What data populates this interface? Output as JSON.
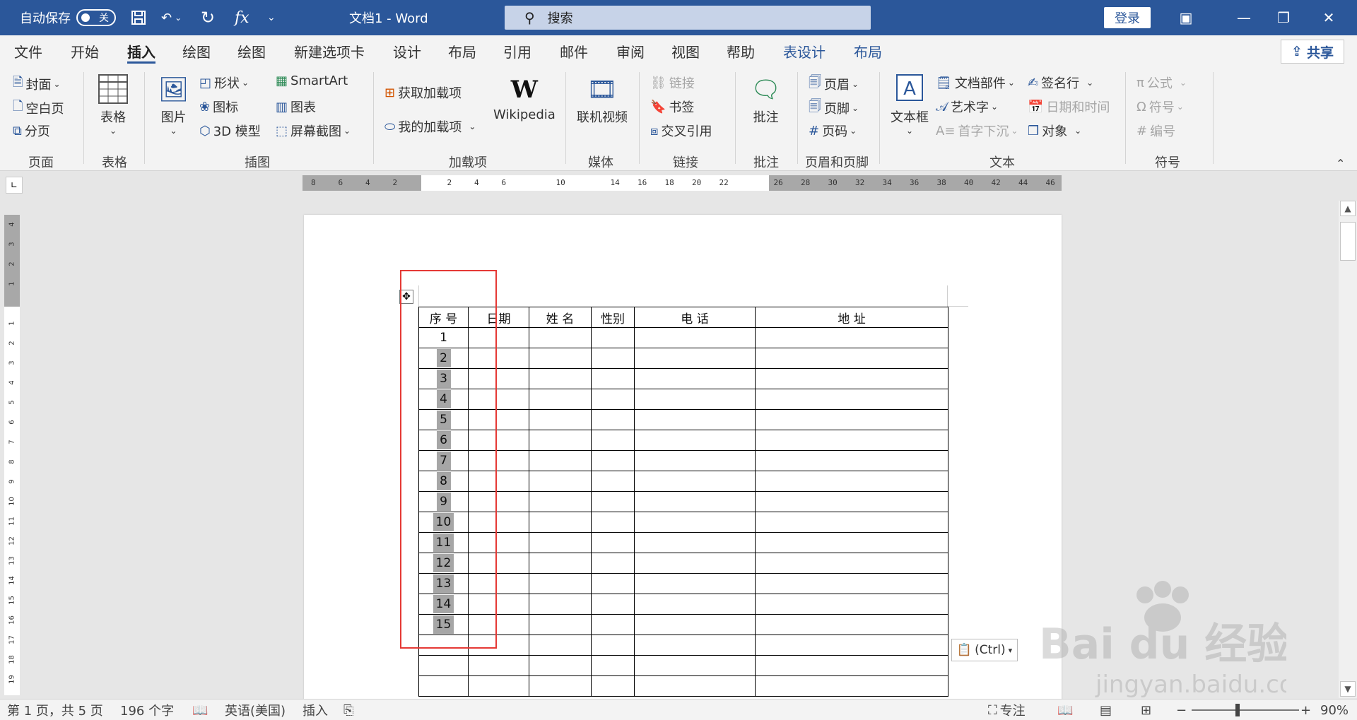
{
  "titlebar": {
    "autosave_label": "自动保存",
    "autosave_state": "关",
    "undo_icon": "undo-icon",
    "fx_label": "fx",
    "doc_title": "文档1 - Word",
    "search_placeholder": "搜索",
    "login_label": "登录"
  },
  "tabs": [
    "文件",
    "开始",
    "插入",
    "绘图",
    "绘图",
    "新建选项卡",
    "设计",
    "布局",
    "引用",
    "邮件",
    "审阅",
    "视图",
    "帮助",
    "表设计",
    "布局"
  ],
  "share_label": "共享",
  "ribbon": {
    "page_group": {
      "items": [
        "封面",
        "空白页",
        "分页"
      ],
      "label": "页面"
    },
    "table_group": {
      "button": "表格",
      "label": "表格"
    },
    "illus_group": {
      "picture": "图片",
      "shapes": "形状",
      "icons": "图标",
      "model3d": "3D 模型",
      "smartart": "SmartArt",
      "chart": "图表",
      "screenshot": "屏幕截图",
      "label": "插图"
    },
    "addins_group": {
      "get": "获取加载项",
      "mine": "我的加载项",
      "wiki": "Wikipedia",
      "label": "加载项"
    },
    "media_group": {
      "video": "联机视频",
      "label": "媒体"
    },
    "links_group": {
      "link": "链接",
      "bookmark": "书签",
      "cross": "交叉引用",
      "label": "链接"
    },
    "comment_group": {
      "comment": "批注",
      "label": "批注"
    },
    "hf_group": {
      "header": "页眉",
      "footer": "页脚",
      "pagenum": "页码",
      "label": "页眉和页脚"
    },
    "text_group": {
      "textbox": "文本框",
      "parts": "文档部件",
      "wordart": "艺术字",
      "dropcap": "首字下沉",
      "sig": "签名行",
      "datetime": "日期和时间",
      "object": "对象",
      "label": "文本"
    },
    "symbols_group": {
      "equation": "公式",
      "symbol": "符号",
      "number": "编号",
      "label": "符号"
    }
  },
  "ruler_ticks": [
    "8",
    "6",
    "4",
    "2",
    "",
    "2",
    "4",
    "6",
    "",
    "10",
    "",
    "14",
    "16",
    "18",
    "20",
    "22",
    "",
    "26",
    "28",
    "30",
    "32",
    "34",
    "36",
    "38",
    "40",
    "42",
    "44",
    "46"
  ],
  "vruler_ticks": [
    "4",
    "3",
    "2",
    "1",
    "",
    "1",
    "2",
    "3",
    "4",
    "5",
    "6",
    "7",
    "8",
    "9",
    "10",
    "11",
    "12",
    "13",
    "14",
    "15",
    "16",
    "17",
    "18",
    "19"
  ],
  "table": {
    "headers": [
      "序 号",
      "日期",
      "姓  名",
      "性别",
      "电  话",
      "地    址"
    ],
    "rows": [
      "1",
      "2",
      "3",
      "4",
      "5",
      "6",
      "7",
      "8",
      "9",
      "10",
      "11",
      "12",
      "13",
      "14",
      "15",
      "",
      "",
      ""
    ]
  },
  "paste_options_label": "(Ctrl)",
  "status": {
    "page": "第 1 页，共 5 页",
    "words": "196 个字",
    "language": "英语(美国)",
    "mode": "插入",
    "focus": "专注",
    "zoom": "90%"
  },
  "watermark": {
    "brand": "Bai du 经验",
    "url": "jingyan.baidu.com"
  }
}
